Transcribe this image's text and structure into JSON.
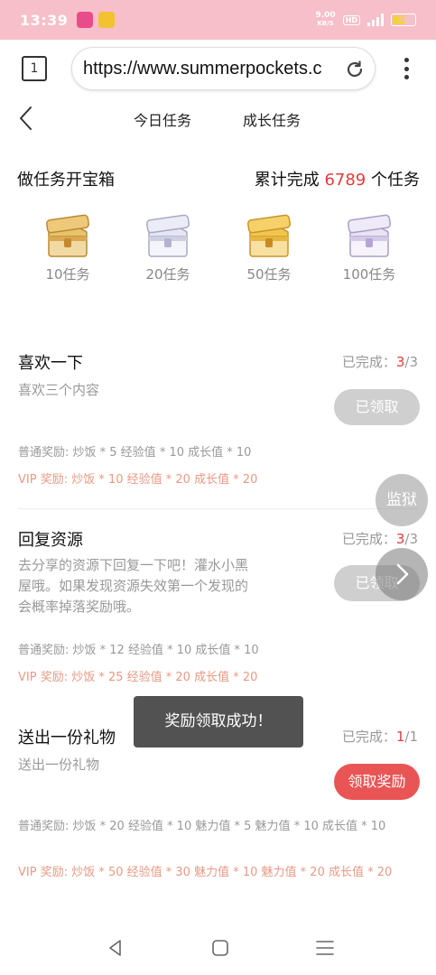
{
  "status_bar": {
    "time": "13:39",
    "net_speed_top": "9.00",
    "net_speed_bottom": "KB/S",
    "hd": "HD",
    "battery": "55"
  },
  "browser": {
    "tab_count": "1",
    "url": "https://www.summerpockets.c"
  },
  "nav": {
    "tabs": [
      "今日任务",
      "成长任务"
    ]
  },
  "chest_section": {
    "title": "做任务开宝箱",
    "total_prefix": "累计完成",
    "total_count": "6789",
    "total_suffix": "个任务",
    "chests": [
      {
        "label": "10任务",
        "color": "gold"
      },
      {
        "label": "20任务",
        "color": "silver"
      },
      {
        "label": "50任务",
        "color": "gold"
      },
      {
        "label": "100任务",
        "color": "silver-purple"
      }
    ]
  },
  "tasks": [
    {
      "title": "喜欢一下",
      "description": "喜欢三个内容",
      "progress_label": "已完成：",
      "progress_done": "3",
      "progress_total": "/3",
      "button": "已领取",
      "normal_rewards": "普通奖励:  炒饭 * 5   经验值 * 10   成长值 * 10",
      "vip_rewards": "VIP 奖励:  炒饭 * 10   经验值 * 20   成长值 * 20"
    },
    {
      "title": "回复资源",
      "description": "去分享的资源下回复一下吧！灌水小黑屋哦。如果发现资源失效第一个发现的会概率掉落奖励哦。",
      "progress_label": "已完成：",
      "progress_done": "3",
      "progress_total": "/3",
      "button": "已领取",
      "normal_rewards": "普通奖励:  炒饭 * 12   经验值 * 10   成长值 * 10",
      "vip_rewards": "VIP 奖励:  炒饭 * 25   经验值 * 20   成长值 * 20"
    },
    {
      "title": "送出一份礼物",
      "description": "送出一份礼物",
      "progress_label": "已完成：",
      "progress_done": "1",
      "progress_total": "/1",
      "button": "领取奖励",
      "normal_rewards": "普通奖励:  炒饭 * 20   经验值 * 10   魅力值 * 5   魅力值 * 10   成长值 * 10",
      "vip_rewards": "VIP 奖励:  炒饭 * 50   经验值 * 30   魅力值 * 10   魅力值 * 20   成长值 * 20"
    }
  ],
  "floating": {
    "prison": "监狱"
  },
  "toast": "奖励领取成功！",
  "colors": {
    "status_bar": "#f6bfc9",
    "accent_red": "#e23b3b",
    "claim_button": "#e95555",
    "vip_text": "#e89a84"
  }
}
